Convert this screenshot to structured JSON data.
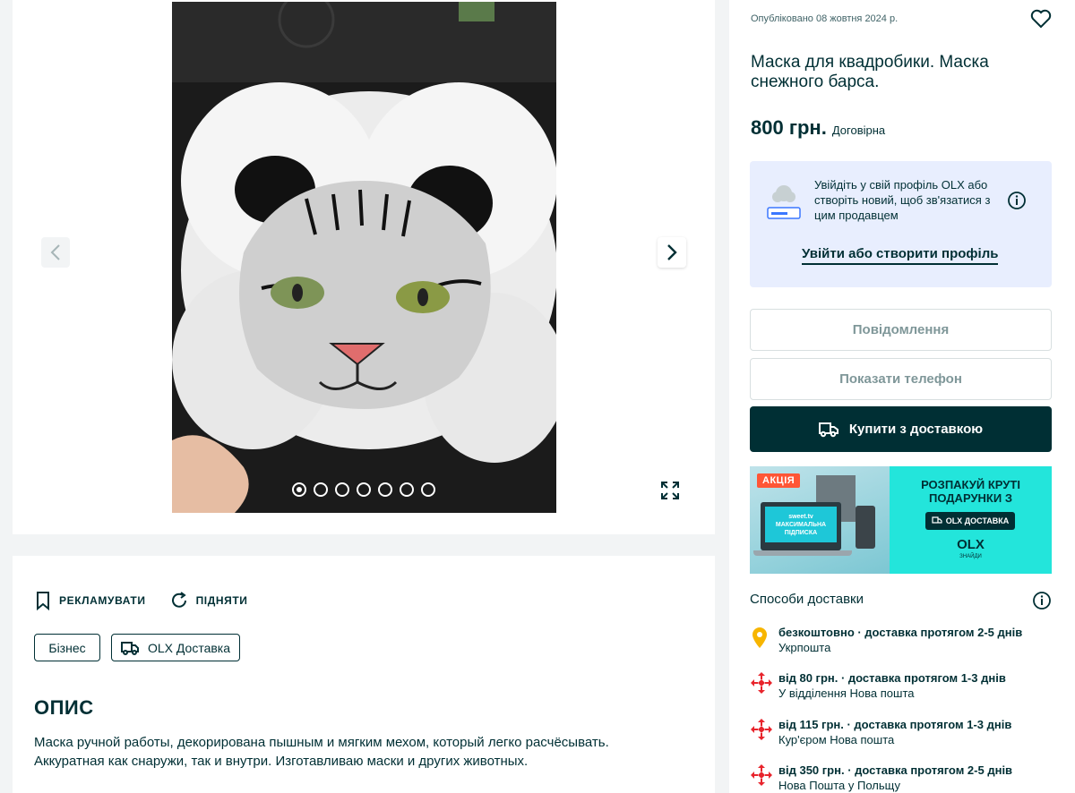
{
  "gallery": {
    "dot_count": 7,
    "active_dot": 1,
    "photo_alt": "Маска для квадробики"
  },
  "ad": {
    "published": "Опубліковано 08 жовтня 2024 р.",
    "title": "Маска для квадробики. Маска снежного барса.",
    "price": "800 грн.",
    "negotiable": "Договірна"
  },
  "login_box": {
    "text": "Увійдіть у свій профіль OLX або створіть новий, щоб зв'язатися з цим продавцем",
    "link": "Увійти або створити профіль"
  },
  "buttons": {
    "message": "Повідомлення",
    "phone": "Показати телефон",
    "buy": "Купити з доставкою"
  },
  "banner": {
    "sale_label": "АКЦІЯ",
    "screen_brand": "sweet.tv",
    "screen_text": "МАКСИМАЛЬНА ПІДПИСКА",
    "headline": "РОЗПАКУЙ КРУТІ ПОДАРУНКИ З",
    "badge": "OLX ДОСТАВКА",
    "logo": "OLX",
    "slogan": "ЗНАЙДИ"
  },
  "delivery": {
    "title": "Способи доставки",
    "options": [
      {
        "main": "безкоштовно · доставка протягом 2-5 днів",
        "sub": "Укрпошта",
        "icon": "pin-icon"
      },
      {
        "main": "від 80 грн. · доставка протягом 1-3 днів",
        "sub": "У відділення Нова пошта",
        "icon": "nova-poshta-icon"
      },
      {
        "main": "від 115 грн. · доставка протягом 1-3 днів",
        "sub": "Кур'єром Нова пошта",
        "icon": "nova-poshta-icon"
      },
      {
        "main": "від 350 грн. · доставка протягом 2-5 днів",
        "sub": "Нова Пошта у Польщу",
        "icon": "nova-poshta-icon"
      }
    ]
  },
  "description": {
    "promote": "РЕКЛАМУВАТИ",
    "bump": "ПІДНЯТИ",
    "tags": [
      "Бізнес",
      "OLX Доставка"
    ],
    "heading": "ОПИС",
    "text": "Маска ручной работы, декорирована пышным и мягким мехом, который легко расчёсывать. Аккуратная как снаружи, так и внутри. Изготавливаю маски и других животных."
  },
  "colors": {
    "primary": "#002f34",
    "login_bg": "#e8eefe",
    "banner_teal": "#23e5db",
    "sale_red": "#ff5636"
  }
}
